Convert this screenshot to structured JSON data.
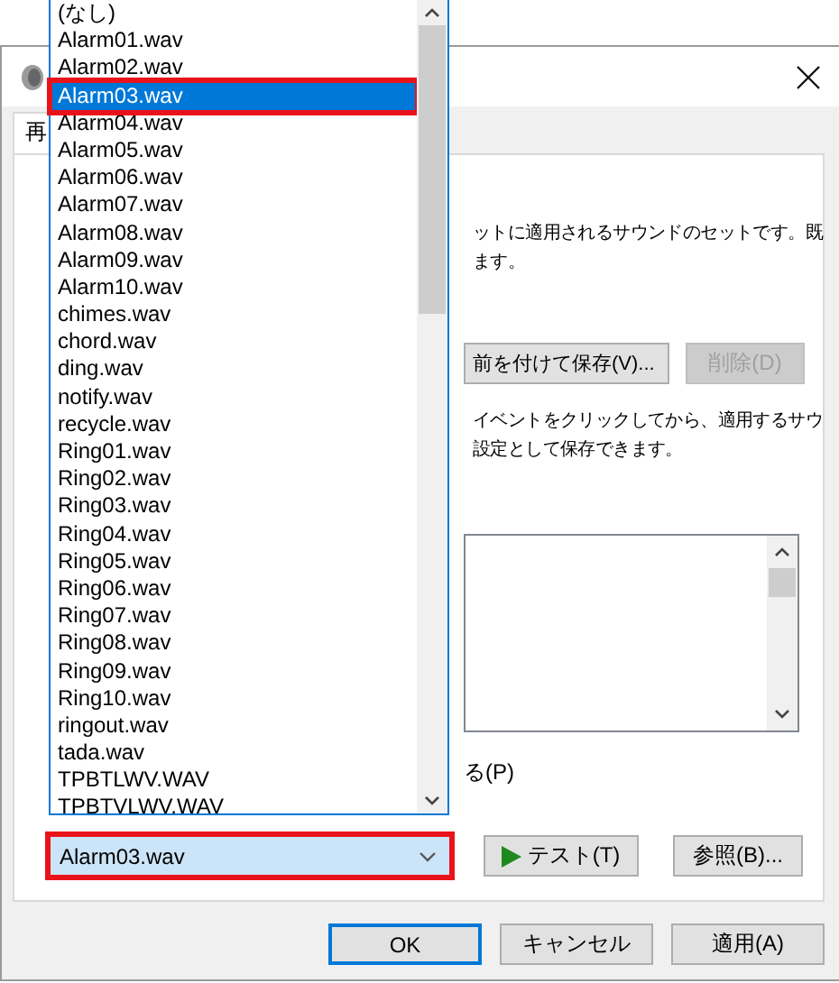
{
  "dialog": {
    "tab": "再",
    "description": [
      "ットに適用されるサウンドのセットです。既",
      "ます。"
    ],
    "save_button": "前を付けて保存(V)...",
    "delete_button": {
      "label": "削除(D)",
      "disabled": true
    },
    "instructions": [
      "イベントをクリックしてから、適用するサウ",
      "設定として保存できます。"
    ],
    "checkbox_label": "る(P)",
    "sound_combo": {
      "value": "Alarm03.wav",
      "annotated": true
    },
    "test_button": "テスト(T)",
    "browse_button": "参照(B)..."
  },
  "dropdown": {
    "items": [
      {
        "label": "(なし)",
        "selected": false
      },
      {
        "label": "Alarm01.wav",
        "selected": false
      },
      {
        "label": "Alarm02.wav",
        "selected": false
      },
      {
        "label": "Alarm03.wav",
        "selected": true
      },
      {
        "label": "Alarm04.wav",
        "selected": false
      },
      {
        "label": "Alarm05.wav",
        "selected": false
      },
      {
        "label": "Alarm06.wav",
        "selected": false
      },
      {
        "label": "Alarm07.wav",
        "selected": false
      },
      {
        "label": "Alarm08.wav",
        "selected": false
      },
      {
        "label": "Alarm09.wav",
        "selected": false
      },
      {
        "label": "Alarm10.wav",
        "selected": false
      },
      {
        "label": "chimes.wav",
        "selected": false
      },
      {
        "label": "chord.wav",
        "selected": false
      },
      {
        "label": "ding.wav",
        "selected": false
      },
      {
        "label": "notify.wav",
        "selected": false
      },
      {
        "label": "recycle.wav",
        "selected": false
      },
      {
        "label": "Ring01.wav",
        "selected": false
      },
      {
        "label": "Ring02.wav",
        "selected": false
      },
      {
        "label": "Ring03.wav",
        "selected": false
      },
      {
        "label": "Ring04.wav",
        "selected": false
      },
      {
        "label": "Ring05.wav",
        "selected": false
      },
      {
        "label": "Ring06.wav",
        "selected": false
      },
      {
        "label": "Ring07.wav",
        "selected": false
      },
      {
        "label": "Ring08.wav",
        "selected": false
      },
      {
        "label": "Ring09.wav",
        "selected": false
      },
      {
        "label": "Ring10.wav",
        "selected": false
      },
      {
        "label": "ringout.wav",
        "selected": false
      },
      {
        "label": "tada.wav",
        "selected": false
      },
      {
        "label": "TPBTLWV.WAV",
        "selected": false
      },
      {
        "label": "TPBTVLWV.WAV",
        "selected": false
      }
    ]
  },
  "footer_buttons": [
    "OK",
    "キャンセル",
    "適用(A)"
  ]
}
